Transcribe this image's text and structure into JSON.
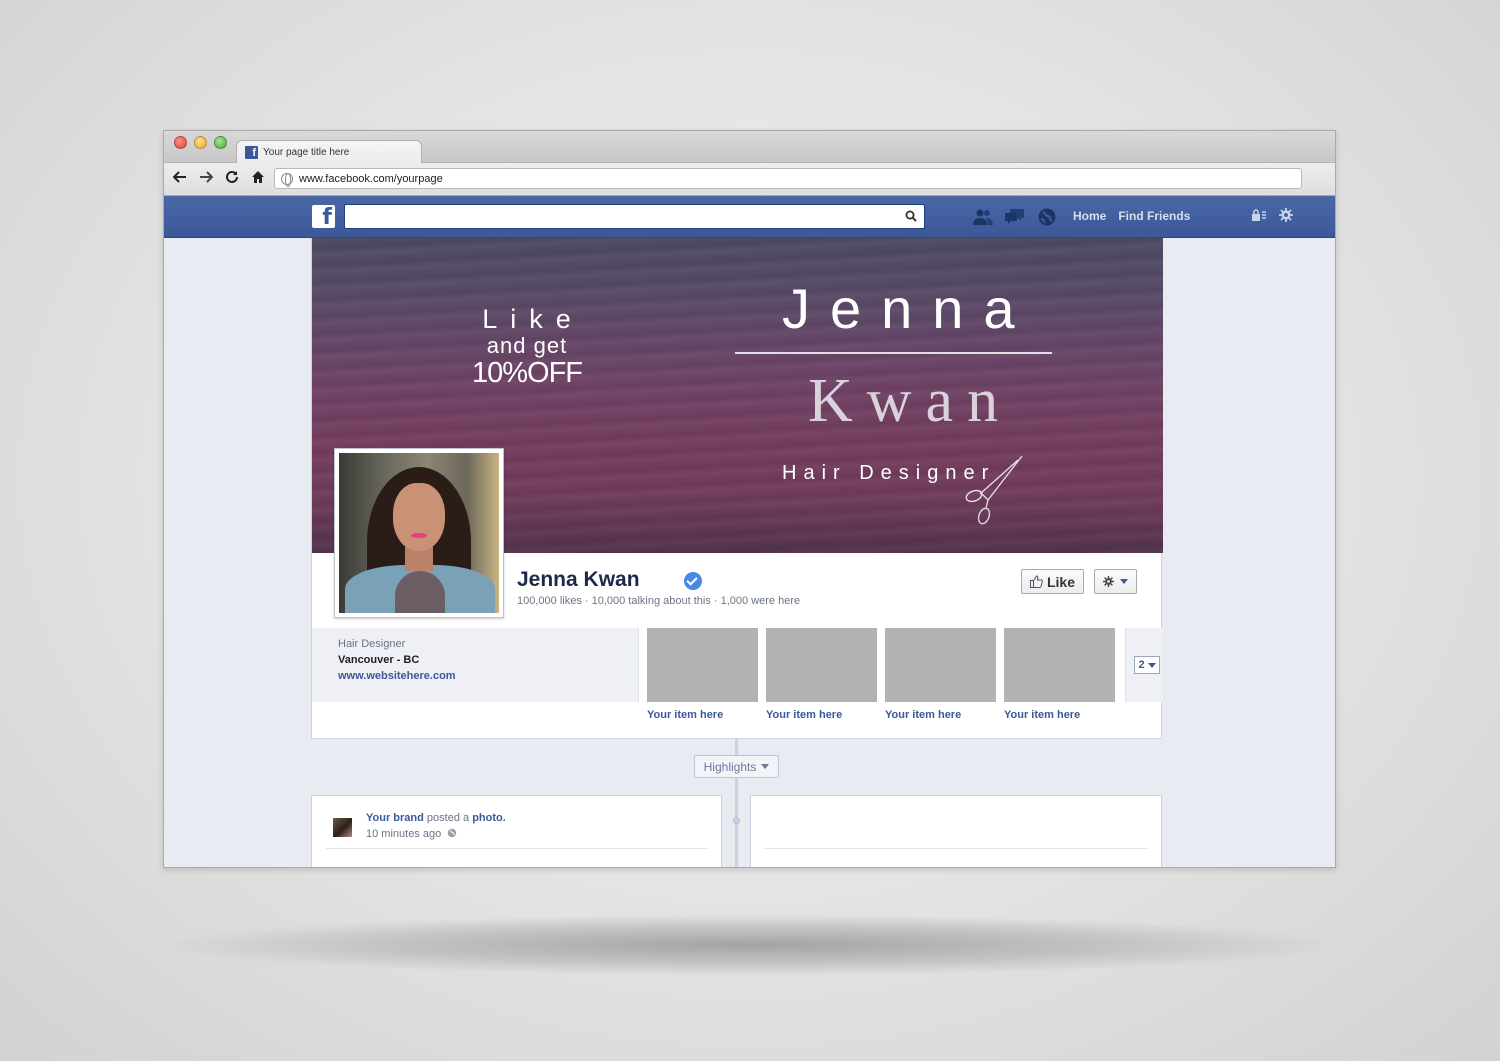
{
  "browser": {
    "tab_title": "Your page title here",
    "url": "www.facebook.com/yourpage",
    "nav_icons": [
      "back-arrow-icon",
      "forward-arrow-icon",
      "reload-icon",
      "home-icon"
    ]
  },
  "fb_header": {
    "logo": "f",
    "search_placeholder": "",
    "links": {
      "home": "Home",
      "find_friends": "Find Friends"
    },
    "icons": [
      "friend-requests-icon",
      "messages-icon",
      "notifications-globe-icon",
      "privacy-shortcuts-icon",
      "settings-gear-icon"
    ],
    "colors": {
      "bar": "#3b5998",
      "link": "#3b5998"
    }
  },
  "cover": {
    "promo": {
      "line1": "Like",
      "line2": "and get",
      "line3": "10%OFF"
    },
    "brand": {
      "first": "Jenna",
      "last": "Kwan",
      "tagline": "Hair Designer"
    }
  },
  "page": {
    "name": "Jenna Kwan",
    "stats": "100,000 likes · 10,000 talking about this · 1,000 were here",
    "like_label": "Like"
  },
  "about": {
    "category": "Hair Designer",
    "location": "Vancouver - BC",
    "website": "www.websitehere.com"
  },
  "apps": [
    {
      "label": "Your item here"
    },
    {
      "label": "Your item here"
    },
    {
      "label": "Your item here"
    },
    {
      "label": "Your item here"
    }
  ],
  "more_count": "2",
  "highlights_label": "Highlights",
  "post": {
    "author": "Your brand",
    "verb": "posted a",
    "object": "photo.",
    "time": "10 minutes ago"
  }
}
